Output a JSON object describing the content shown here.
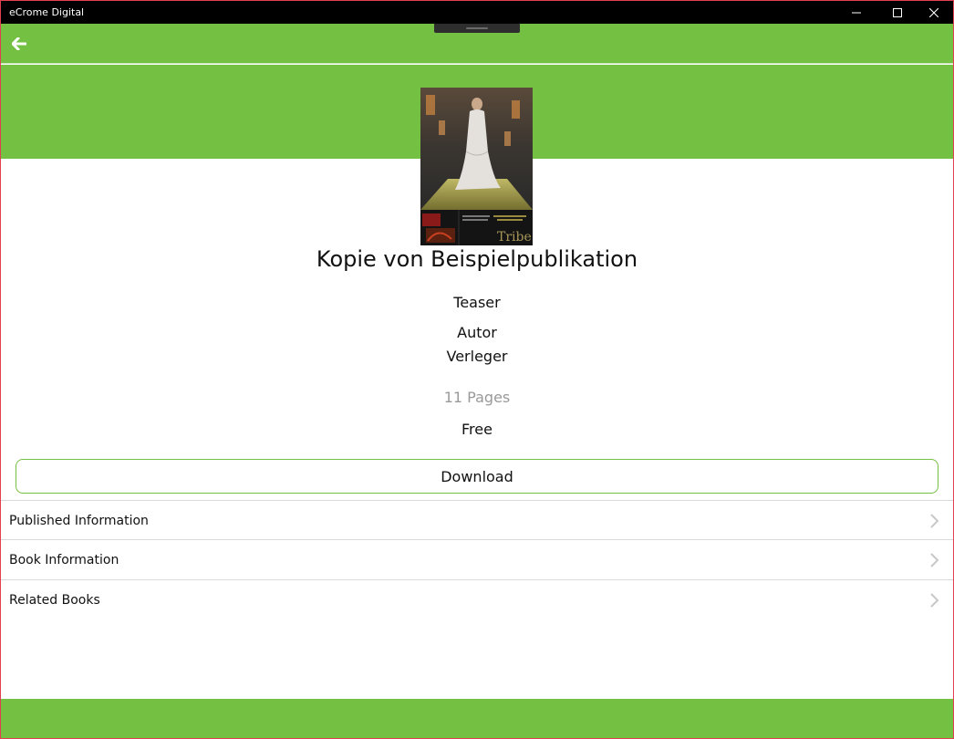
{
  "window": {
    "title": "eCrome Digital",
    "controls": [
      "minimize-icon",
      "maximize-icon",
      "close-icon"
    ]
  },
  "appbar": {
    "back_icon": "arrow-left-icon"
  },
  "colors": {
    "accent": "#74c043",
    "titlebar": "#000000",
    "divider": "#d9d9d9",
    "muted_text": "#9a9a9a"
  },
  "publication": {
    "title": "Kopie von Beispielpublikation",
    "teaser": "Teaser",
    "author": "Autor",
    "publisher": "Verleger",
    "pages": "11 Pages",
    "price": "Free",
    "cover": {
      "brand": "Tribe"
    }
  },
  "actions": {
    "download_label": "Download"
  },
  "sections": [
    {
      "label": "Published Information",
      "icon": "chevron-right-icon"
    },
    {
      "label": "Book Information",
      "icon": "chevron-right-icon"
    },
    {
      "label": "Related Books",
      "icon": "chevron-right-icon"
    }
  ]
}
